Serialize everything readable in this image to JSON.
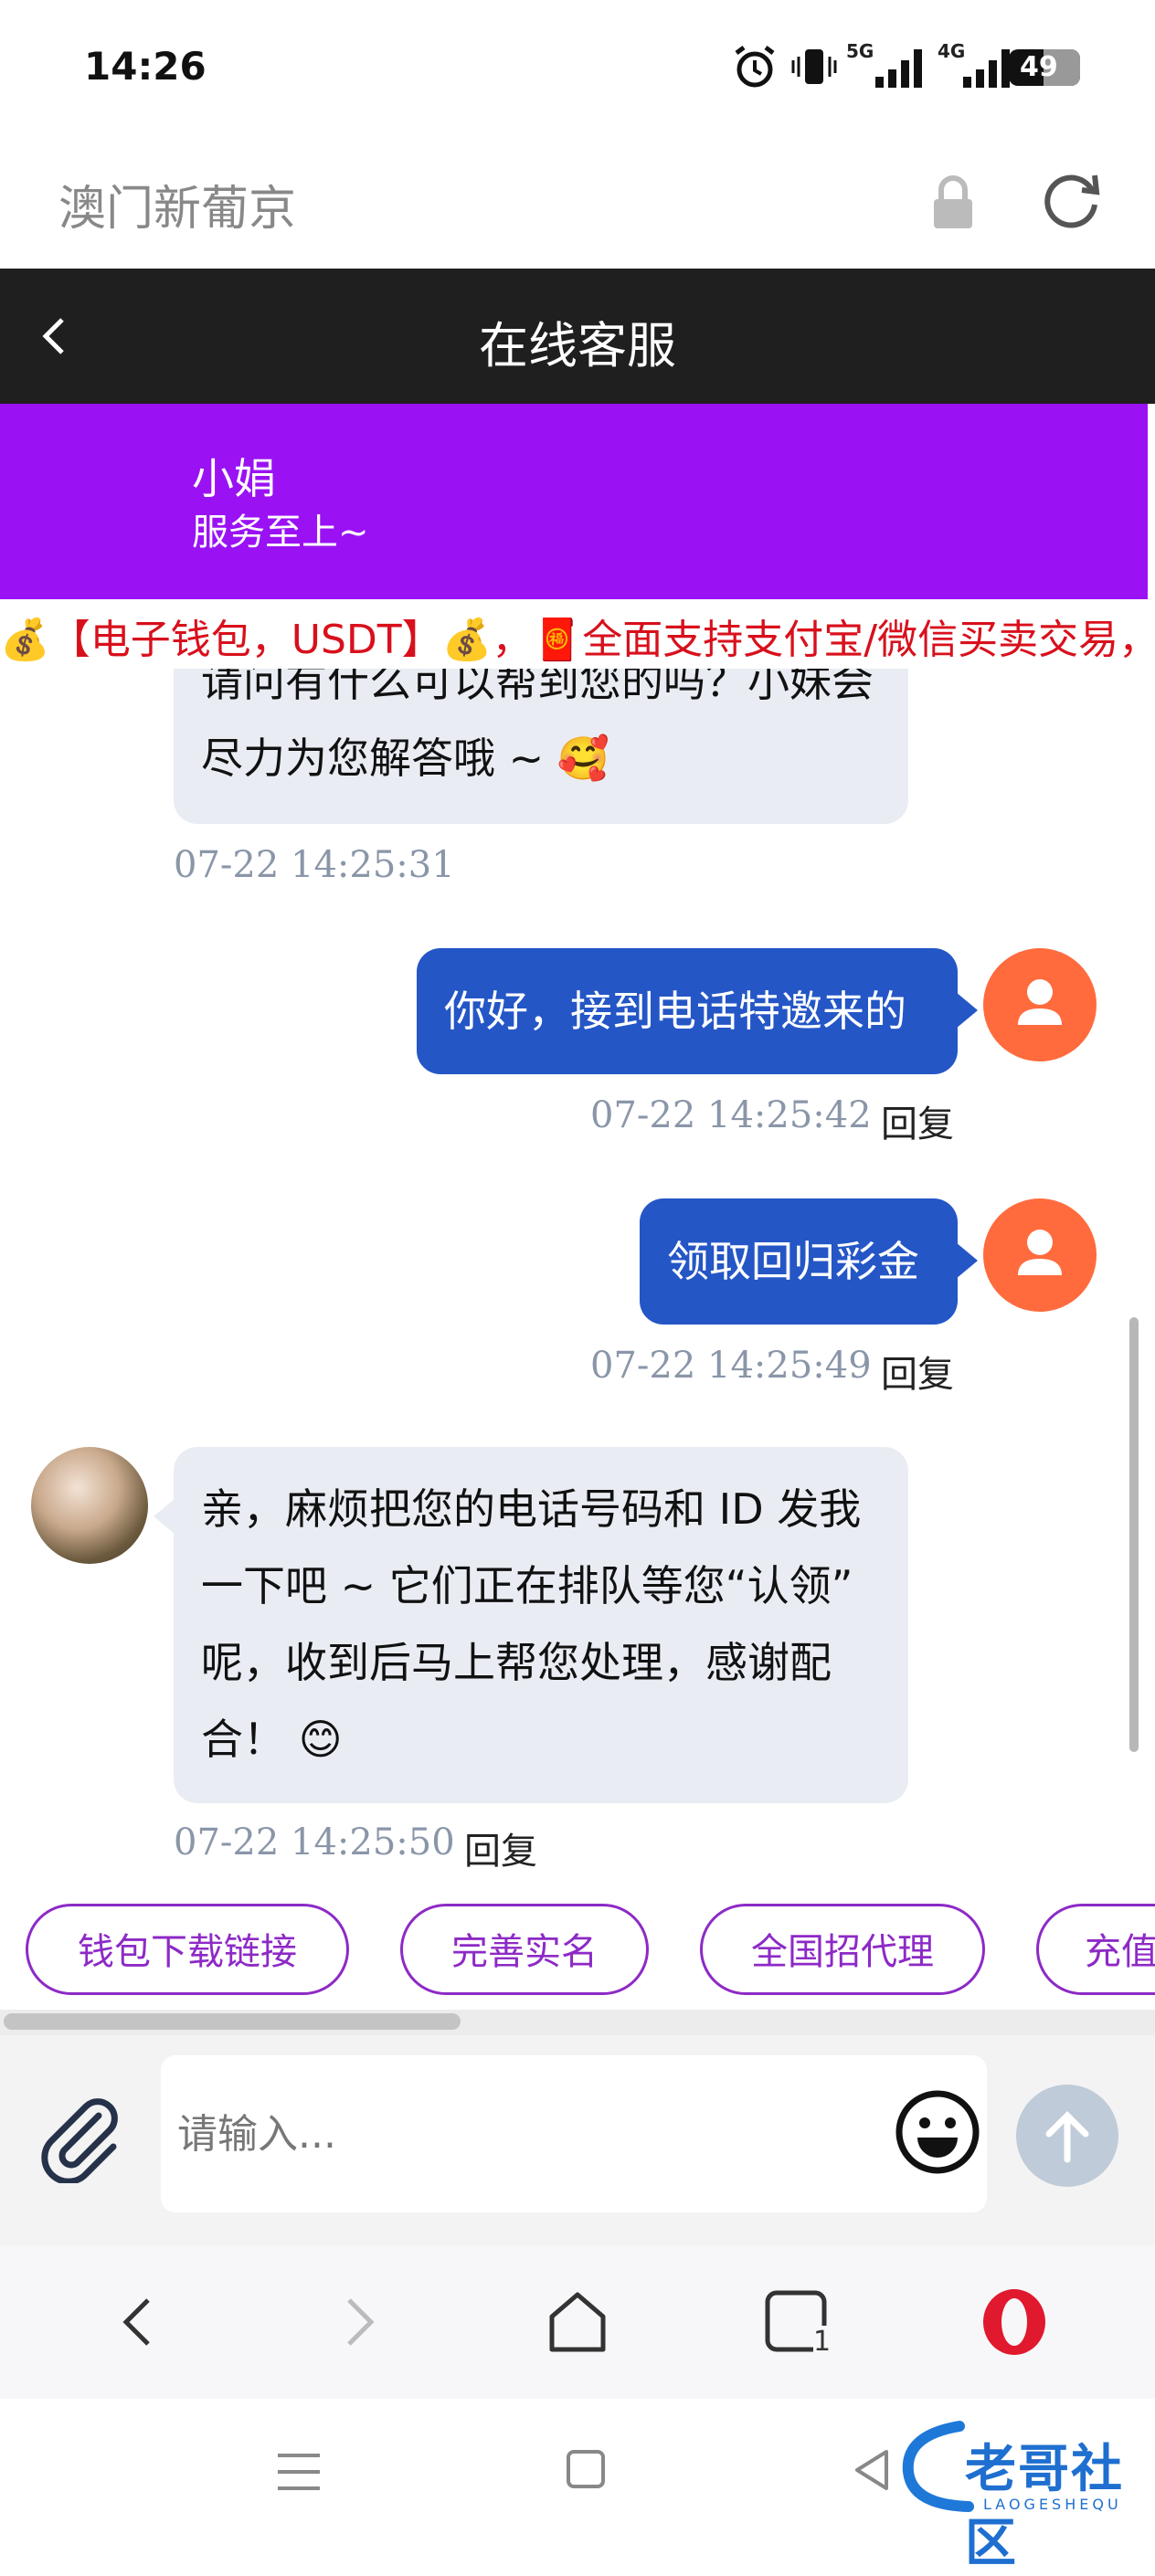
{
  "status_bar": {
    "time": "14:26",
    "network_1": "5G",
    "network_2": "4G",
    "battery": "49",
    "icons": [
      "alarm-icon",
      "vibrate-icon",
      "signal-5g-icon",
      "signal-4g-icon",
      "battery-icon"
    ]
  },
  "browser": {
    "site_title": "澳门新葡京",
    "icons": [
      "lock-icon",
      "reload-icon"
    ]
  },
  "header": {
    "title": "在线客服"
  },
  "agent": {
    "name": "小娟",
    "slogan": "服务至上~"
  },
  "marquee": {
    "text": "💰【电子钱包，USDT】💰，🧧全面支持支付宝/微信买卖交易，"
  },
  "messages": [
    {
      "direction": "in",
      "lines": [
        "请问有什么可以帮到您的吗？小妹会",
        "尽力为您解答哦 ~ 🥰"
      ],
      "time": "07-22 14:25:31"
    },
    {
      "direction": "out",
      "text": "你好，接到电话特邀来的",
      "time": "07-22 14:25:42",
      "reply": "回复"
    },
    {
      "direction": "out",
      "text": "领取回归彩金",
      "time": "07-22 14:25:49",
      "reply": "回复"
    },
    {
      "direction": "in",
      "lines": [
        "亲，麻烦把您的电话号码和 ID 发我",
        "一下吧 ~ 它们正在排队等您“认领”",
        "呢，收到后马上帮您处理，感谢配",
        "合！ 😊"
      ],
      "time": "07-22 14:25:50",
      "reply": "回复"
    }
  ],
  "quick_replies": [
    "钱包下载链接",
    "完善实名",
    "全国招代理",
    "充值"
  ],
  "input": {
    "placeholder": "请输入..."
  },
  "browser_nav": {
    "tab_count": "1",
    "icons": [
      "back-icon",
      "forward-icon",
      "home-icon",
      "tabs-icon",
      "opera-icon"
    ]
  },
  "watermark": {
    "text": "老哥社区",
    "subtext": "LAOGESHEQU"
  },
  "colors": {
    "banner": "#9a12f4",
    "header": "#1f1f1f",
    "out_bubble": "#2456c6",
    "in_bubble": "#e9edf3",
    "avatar": "#ff6b3d",
    "chip": "#8d2ac6",
    "marquee": "#d8101c"
  }
}
